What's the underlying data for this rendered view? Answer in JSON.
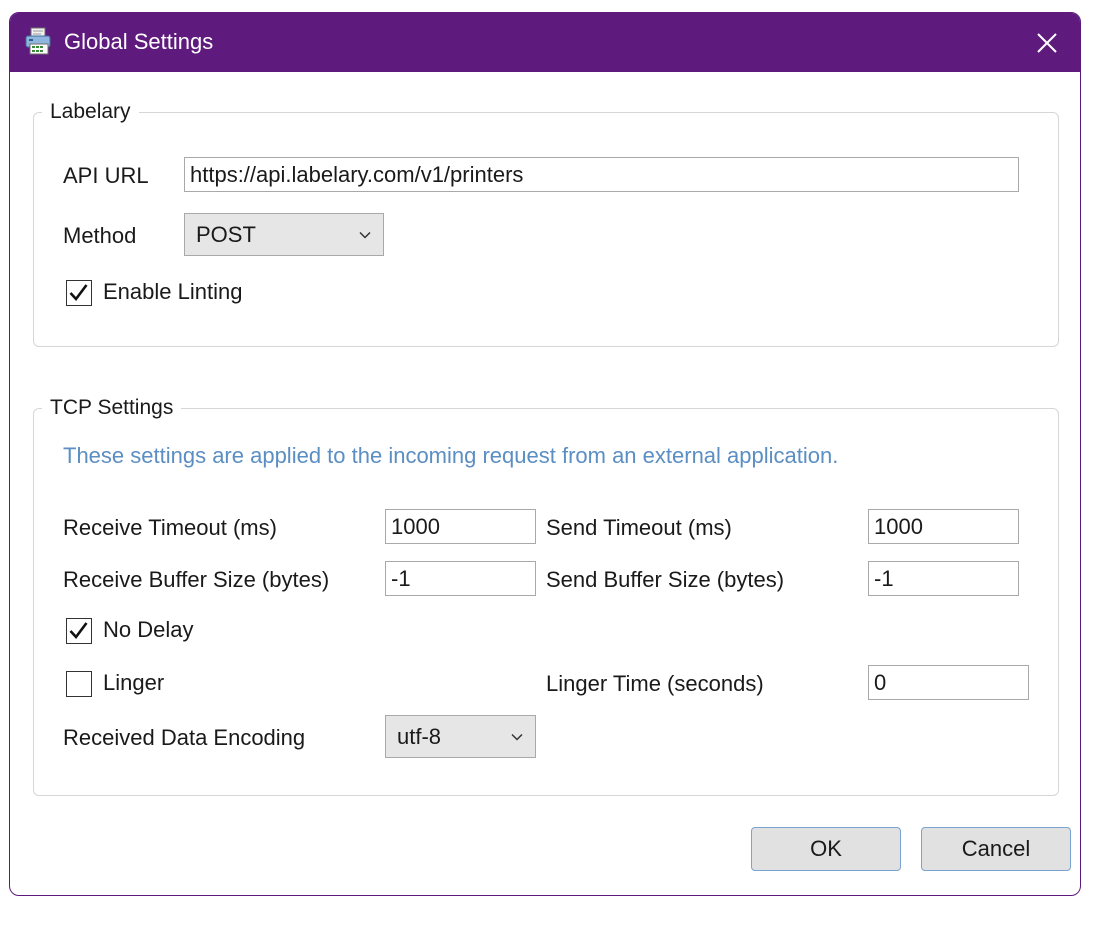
{
  "window": {
    "title": "Global Settings"
  },
  "labelary": {
    "legend": "Labelary",
    "api_url_label": "API URL",
    "api_url_value": "https://api.labelary.com/v1/printers",
    "method_label": "Method",
    "method_value": "POST",
    "linting_label": "Enable Linting",
    "linting_checked": true
  },
  "tcp": {
    "legend": "TCP Settings",
    "info": "These settings are applied to the incoming request from an external application.",
    "receive_timeout_label": "Receive Timeout (ms)",
    "receive_timeout_value": "1000",
    "send_timeout_label": "Send Timeout (ms)",
    "send_timeout_value": "1000",
    "receive_buffer_label": "Receive Buffer Size (bytes)",
    "receive_buffer_value": "-1",
    "send_buffer_label": "Send Buffer Size (bytes)",
    "send_buffer_value": "-1",
    "no_delay_label": "No Delay",
    "no_delay_checked": true,
    "linger_label": "Linger",
    "linger_checked": false,
    "linger_time_label": "Linger Time (seconds)",
    "linger_time_value": "0",
    "encoding_label": "Received Data Encoding",
    "encoding_value": "utf-8"
  },
  "buttons": {
    "ok": "OK",
    "cancel": "Cancel"
  },
  "colors": {
    "titlebar": "#5e1a7d",
    "info_text": "#5b8ec2",
    "button_border": "#7aa3d1"
  },
  "icons": {
    "app": "printer-icon",
    "close": "close-icon",
    "dropdown": "chevron-down-icon",
    "check": "checkmark-icon"
  }
}
